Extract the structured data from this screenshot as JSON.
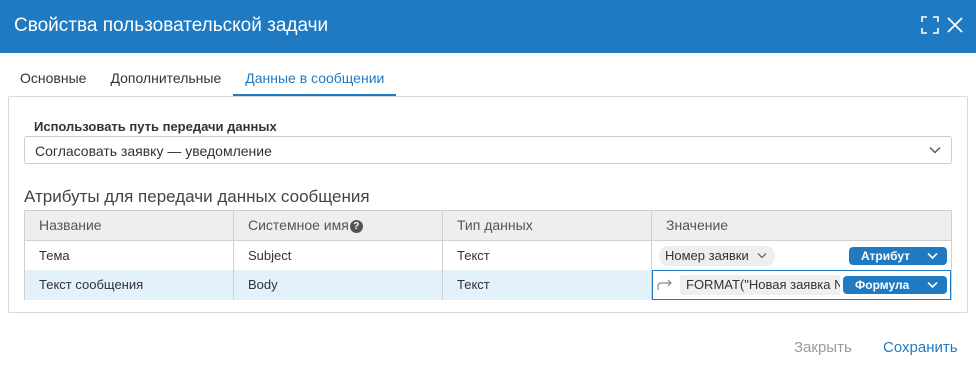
{
  "dialog": {
    "title": "Свойства пользовательской задачи",
    "icons": [
      "expand-icon",
      "close-icon"
    ]
  },
  "tabs": [
    {
      "label": "Основные",
      "active": false
    },
    {
      "label": "Дополнительные",
      "active": false
    },
    {
      "label": "Данные в сообщении",
      "active": true
    }
  ],
  "route": {
    "label": "Использовать путь передачи данных",
    "value": "Согласовать заявку — уведомление"
  },
  "attributes": {
    "title": "Атрибуты для передачи данных сообщения",
    "columns": [
      "Название",
      "Системное имя",
      "Тип данных",
      "Значение"
    ],
    "rows": [
      {
        "name": "Тема",
        "system_name": "Subject",
        "type": "Текст",
        "value": "Номер заявки",
        "mode": "Атрибут"
      },
      {
        "name": "Текст сообщения",
        "system_name": "Body",
        "type": "Текст",
        "value": "FORMAT(\"Новая заявка №",
        "mode": "Формула"
      }
    ]
  },
  "footer": {
    "close_label": "Закрыть",
    "save_label": "Сохранить"
  },
  "colors": {
    "accent": "#1f7ac2",
    "selected_row": "#e3f1fb",
    "disabled_text": "#9a9a9a"
  }
}
